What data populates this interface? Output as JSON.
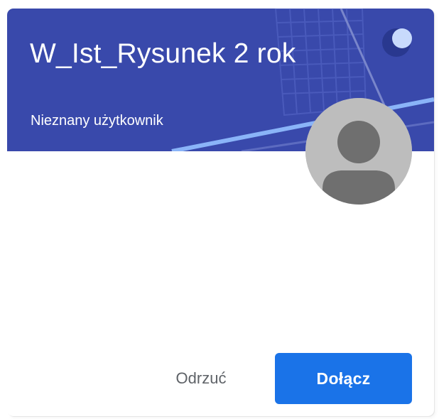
{
  "invite_card": {
    "class_title": "W_Ist_Rysunek 2 rok",
    "owner_name": "Nieznany użytkownik",
    "banner_color": "#3949ab",
    "banner_accent_color": "#8ab4f8",
    "avatar_icon": "person-silhouette-icon",
    "reject_label": "Odrzuć",
    "join_label": "Dołącz",
    "join_button_color": "#1a73e8"
  }
}
